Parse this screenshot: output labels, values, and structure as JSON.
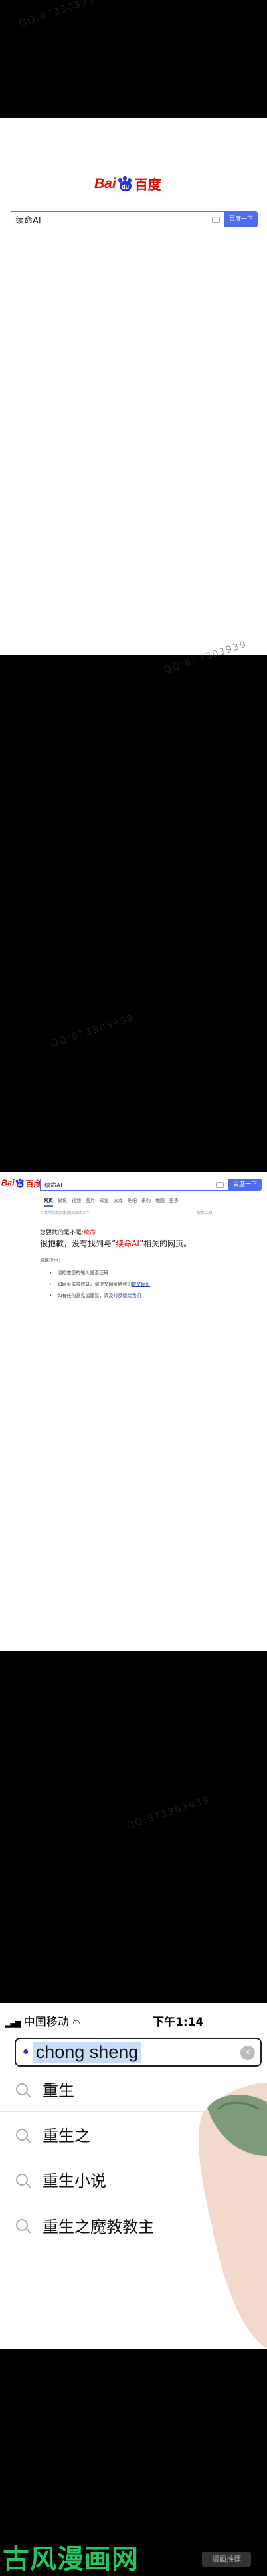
{
  "watermark": "QQ:873303939",
  "home": {
    "logo_text": "Bai",
    "logo_paw": "du",
    "logo_cn": "百度",
    "query": "续命AI",
    "button": "百度一下"
  },
  "results": {
    "query": "续命AI",
    "button": "百度一下",
    "tabs": [
      "网页",
      "资讯",
      "视频",
      "图片",
      "知道",
      "文库",
      "贴吧",
      "采购",
      "地图",
      "更多"
    ],
    "tools": "搜索工具",
    "stats": "百度为您找到相关结果约0个",
    "notice_prefix": "您要找的是不是:",
    "notice_link": "续命",
    "no_result_prefix": "很抱歉，没有找到与“",
    "no_result_query": "续命AI",
    "no_result_suffix": "”相关的网页。",
    "suggest_head": "温馨提示：",
    "suggestions": [
      {
        "text": "请检查您的输入是否正确",
        "link": ""
      },
      {
        "text": "如网页未被收录，请提交网址给我们",
        "link": "提交网址"
      },
      {
        "text": "如有任何意见或建议，请及时",
        "link": "反馈给我们"
      }
    ]
  },
  "phone": {
    "carrier": "中国移动",
    "time": "下午1:14",
    "query": "chong sheng",
    "suggestions": [
      "重生",
      "重生之",
      "重生小说",
      "重生之魔教教主"
    ]
  },
  "footer": {
    "site_logo": "古风漫画网",
    "button": "漫画推荐"
  }
}
